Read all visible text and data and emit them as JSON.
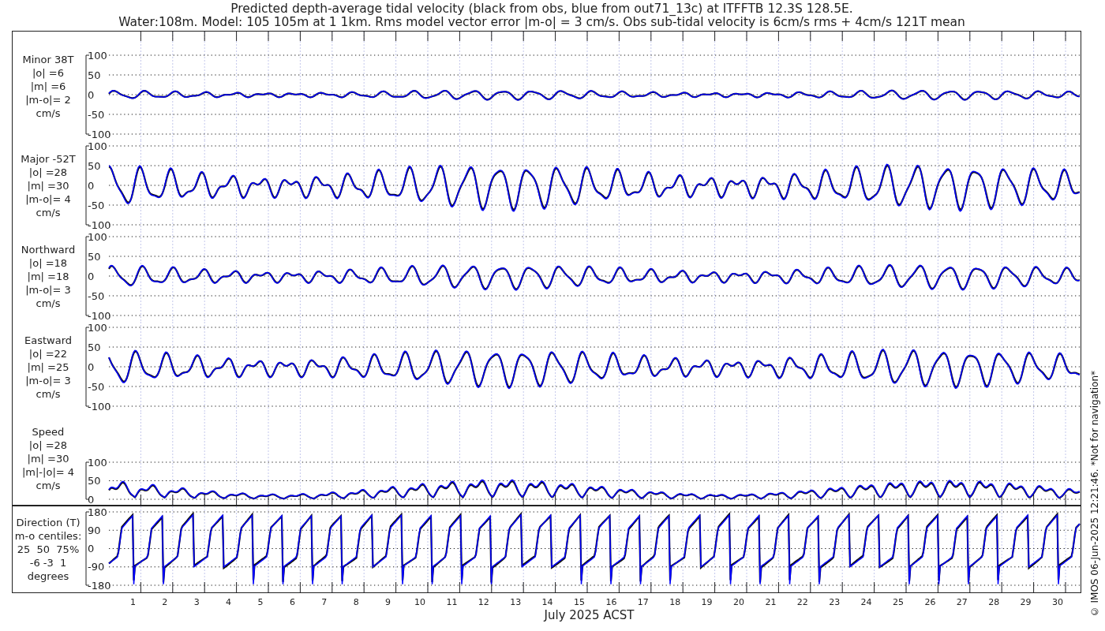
{
  "title": {
    "line_1": "Predicted depth-average tidal velocity (black from obs, blue from out71_13c) at ITFFTB 12.3S 128.5E.",
    "line_2": "Water:108m. Model: 105 105m at 1 1km. Rms model vector error |m-o| = 3 cm/s. Obs sub-tidal velocity is 6cm/s rms + 4cm/s 121T mean"
  },
  "panels": [
    {
      "kind": "velocity",
      "label": [
        "Minor 38T",
        "|o| =6",
        "|m| =6",
        "|m-o|= 2",
        "cm/s"
      ],
      "yticks": [
        "100",
        "50",
        "0",
        "-50",
        "-100"
      ]
    },
    {
      "kind": "velocity",
      "label": [
        "Major -52T",
        "|o| =28",
        "|m| =30",
        "|m-o|= 4",
        "cm/s"
      ],
      "yticks": [
        "100",
        "50",
        "0",
        "-50",
        "-100"
      ]
    },
    {
      "kind": "velocity",
      "label": [
        "Northward",
        "|o| =18",
        "|m| =18",
        "|m-o|= 3",
        "cm/s"
      ],
      "yticks": [
        "100",
        "50",
        "0",
        "-50",
        "-100"
      ]
    },
    {
      "kind": "velocity",
      "label": [
        "Eastward",
        "|o| =22",
        "|m| =25",
        "|m-o|= 3",
        "cm/s"
      ],
      "yticks": [
        "100",
        "50",
        "0",
        "-50",
        "-100"
      ]
    },
    {
      "kind": "speed",
      "label": [
        "Speed",
        "|o| =28",
        "|m| =30",
        "|m|-|o|= 4",
        "cm/s"
      ],
      "yticks": [
        "100",
        "50",
        "0"
      ]
    },
    {
      "kind": "direction",
      "label": [
        "Direction (T)",
        "m-o centiles:",
        "25  50  75%",
        "-6 -3  1",
        "degrees"
      ],
      "yticks": [
        "180",
        "90",
        "0",
        "-90",
        "-180"
      ]
    }
  ],
  "x_axis": {
    "day_labels": [
      "1",
      "2",
      "3",
      "4",
      "5",
      "6",
      "7",
      "8",
      "9",
      "10",
      "11",
      "12",
      "13",
      "14",
      "15",
      "16",
      "17",
      "18",
      "19",
      "20",
      "21",
      "22",
      "23",
      "24",
      "25",
      "26",
      "27",
      "28",
      "29",
      "30"
    ],
    "xlabel": "July 2025 ACST"
  },
  "credit": "© IMOS 06-Jun-2025 12:21:46. *Not for navigation*"
}
